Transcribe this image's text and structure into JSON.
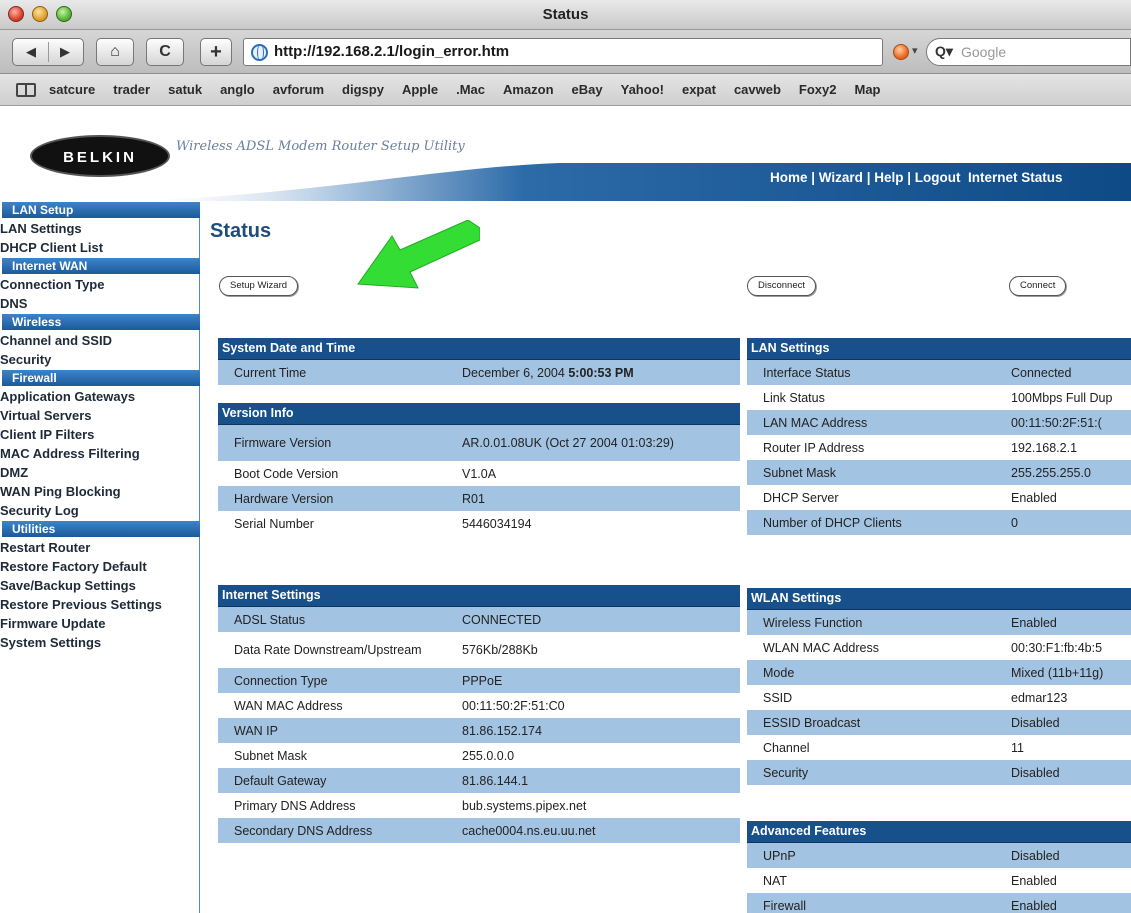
{
  "browser": {
    "window_title": "Status",
    "url": "http://192.168.2.1/login_error.htm",
    "search_placeholder": "Google",
    "bookmarks": [
      "satcure",
      "trader",
      "satuk",
      "anglo",
      "avforum",
      "digspy",
      "Apple",
      ".Mac",
      "Amazon",
      "eBay",
      "Yahoo!",
      "expat",
      "cavweb",
      "Foxy2",
      "Map"
    ]
  },
  "header": {
    "logo": "BELKIN",
    "tagline": "Wireless ADSL Modem Router Setup Utility",
    "nav": [
      "Home",
      "Wizard",
      "Help",
      "Logout",
      "Internet Status"
    ]
  },
  "sidebar": [
    {
      "heading": "LAN Setup",
      "items": [
        "LAN Settings",
        "DHCP Client List"
      ]
    },
    {
      "heading": "Internet WAN",
      "items": [
        "Connection Type",
        "DNS"
      ]
    },
    {
      "heading": "Wireless",
      "items": [
        "Channel and SSID",
        "Security"
      ]
    },
    {
      "heading": "Firewall",
      "items": [
        "Application Gateways",
        "Virtual Servers",
        "Client IP Filters",
        "MAC Address Filtering",
        "DMZ",
        "WAN Ping Blocking",
        "Security Log"
      ]
    },
    {
      "heading": "Utilities",
      "items": [
        "Restart Router",
        "Restore Factory Default",
        "Save/Backup Settings",
        "Restore Previous Settings",
        "Firmware Update",
        "System Settings"
      ]
    }
  ],
  "main": {
    "title": "Status",
    "buttons": {
      "setup_wizard": "Setup Wizard",
      "disconnect": "Disconnect",
      "connect": "Connect"
    },
    "system_date": {
      "heading": "System Date and Time",
      "label": "Current Time",
      "date": "December 6, 2004",
      "time": "5:00:53 PM"
    },
    "version_info": {
      "heading": "Version Info",
      "rows": [
        {
          "k": "Firmware Version",
          "v": "AR.0.01.08UK (Oct 27 2004 01:03:29)"
        },
        {
          "k": "Boot Code Version",
          "v": "V1.0A"
        },
        {
          "k": "Hardware Version",
          "v": "R01"
        },
        {
          "k": "Serial Number",
          "v": "5446034194"
        }
      ]
    },
    "internet_settings": {
      "heading": "Internet Settings",
      "rows": [
        {
          "k": "ADSL Status",
          "v": "CONNECTED"
        },
        {
          "k": "Data Rate Downstream/Upstream",
          "v": "576Kb/288Kb"
        },
        {
          "k": "Connection Type",
          "v": "PPPoE"
        },
        {
          "k": "WAN MAC Address",
          "v": "00:11:50:2F:51:C0"
        },
        {
          "k": "WAN IP",
          "v": "81.86.152.174"
        },
        {
          "k": "Subnet Mask",
          "v": "255.0.0.0"
        },
        {
          "k": "Default Gateway",
          "v": "81.86.144.1"
        },
        {
          "k": "Primary DNS Address",
          "v": "bub.systems.pipex.net"
        },
        {
          "k": "Secondary DNS Address",
          "v": "cache0004.ns.eu.uu.net"
        }
      ]
    },
    "lan_settings": {
      "heading": "LAN Settings",
      "rows": [
        {
          "k": "Interface Status",
          "v": "Connected"
        },
        {
          "k": "Link Status",
          "v": "100Mbps Full Dup"
        },
        {
          "k": "LAN MAC Address",
          "v": "00:11:50:2F:51:("
        },
        {
          "k": "Router IP Address",
          "v": "192.168.2.1"
        },
        {
          "k": "Subnet Mask",
          "v": "255.255.255.0"
        },
        {
          "k": "DHCP Server",
          "v": "Enabled"
        },
        {
          "k": "Number of DHCP Clients",
          "v": "0"
        }
      ]
    },
    "wlan_settings": {
      "heading": "WLAN Settings",
      "rows": [
        {
          "k": "Wireless Function",
          "v": "Enabled"
        },
        {
          "k": "WLAN MAC Address",
          "v": "00:30:F1:fb:4b:5"
        },
        {
          "k": "Mode",
          "v": "Mixed (11b+11g)"
        },
        {
          "k": "SSID",
          "v": "edmar123"
        },
        {
          "k": "ESSID Broadcast",
          "v": "Disabled"
        },
        {
          "k": "Channel",
          "v": "11"
        },
        {
          "k": "Security",
          "v": "Disabled"
        }
      ]
    },
    "advanced_features": {
      "heading": "Advanced Features",
      "rows": [
        {
          "k": "UPnP",
          "v": "Disabled"
        },
        {
          "k": "NAT",
          "v": "Enabled"
        },
        {
          "k": "Firewall",
          "v": "Enabled"
        }
      ]
    }
  },
  "colors": {
    "accent": "#17508a",
    "row_alt": "#a3c3e2",
    "sidebar_head": "#1a5a9a",
    "arrow": "#33dd33"
  }
}
